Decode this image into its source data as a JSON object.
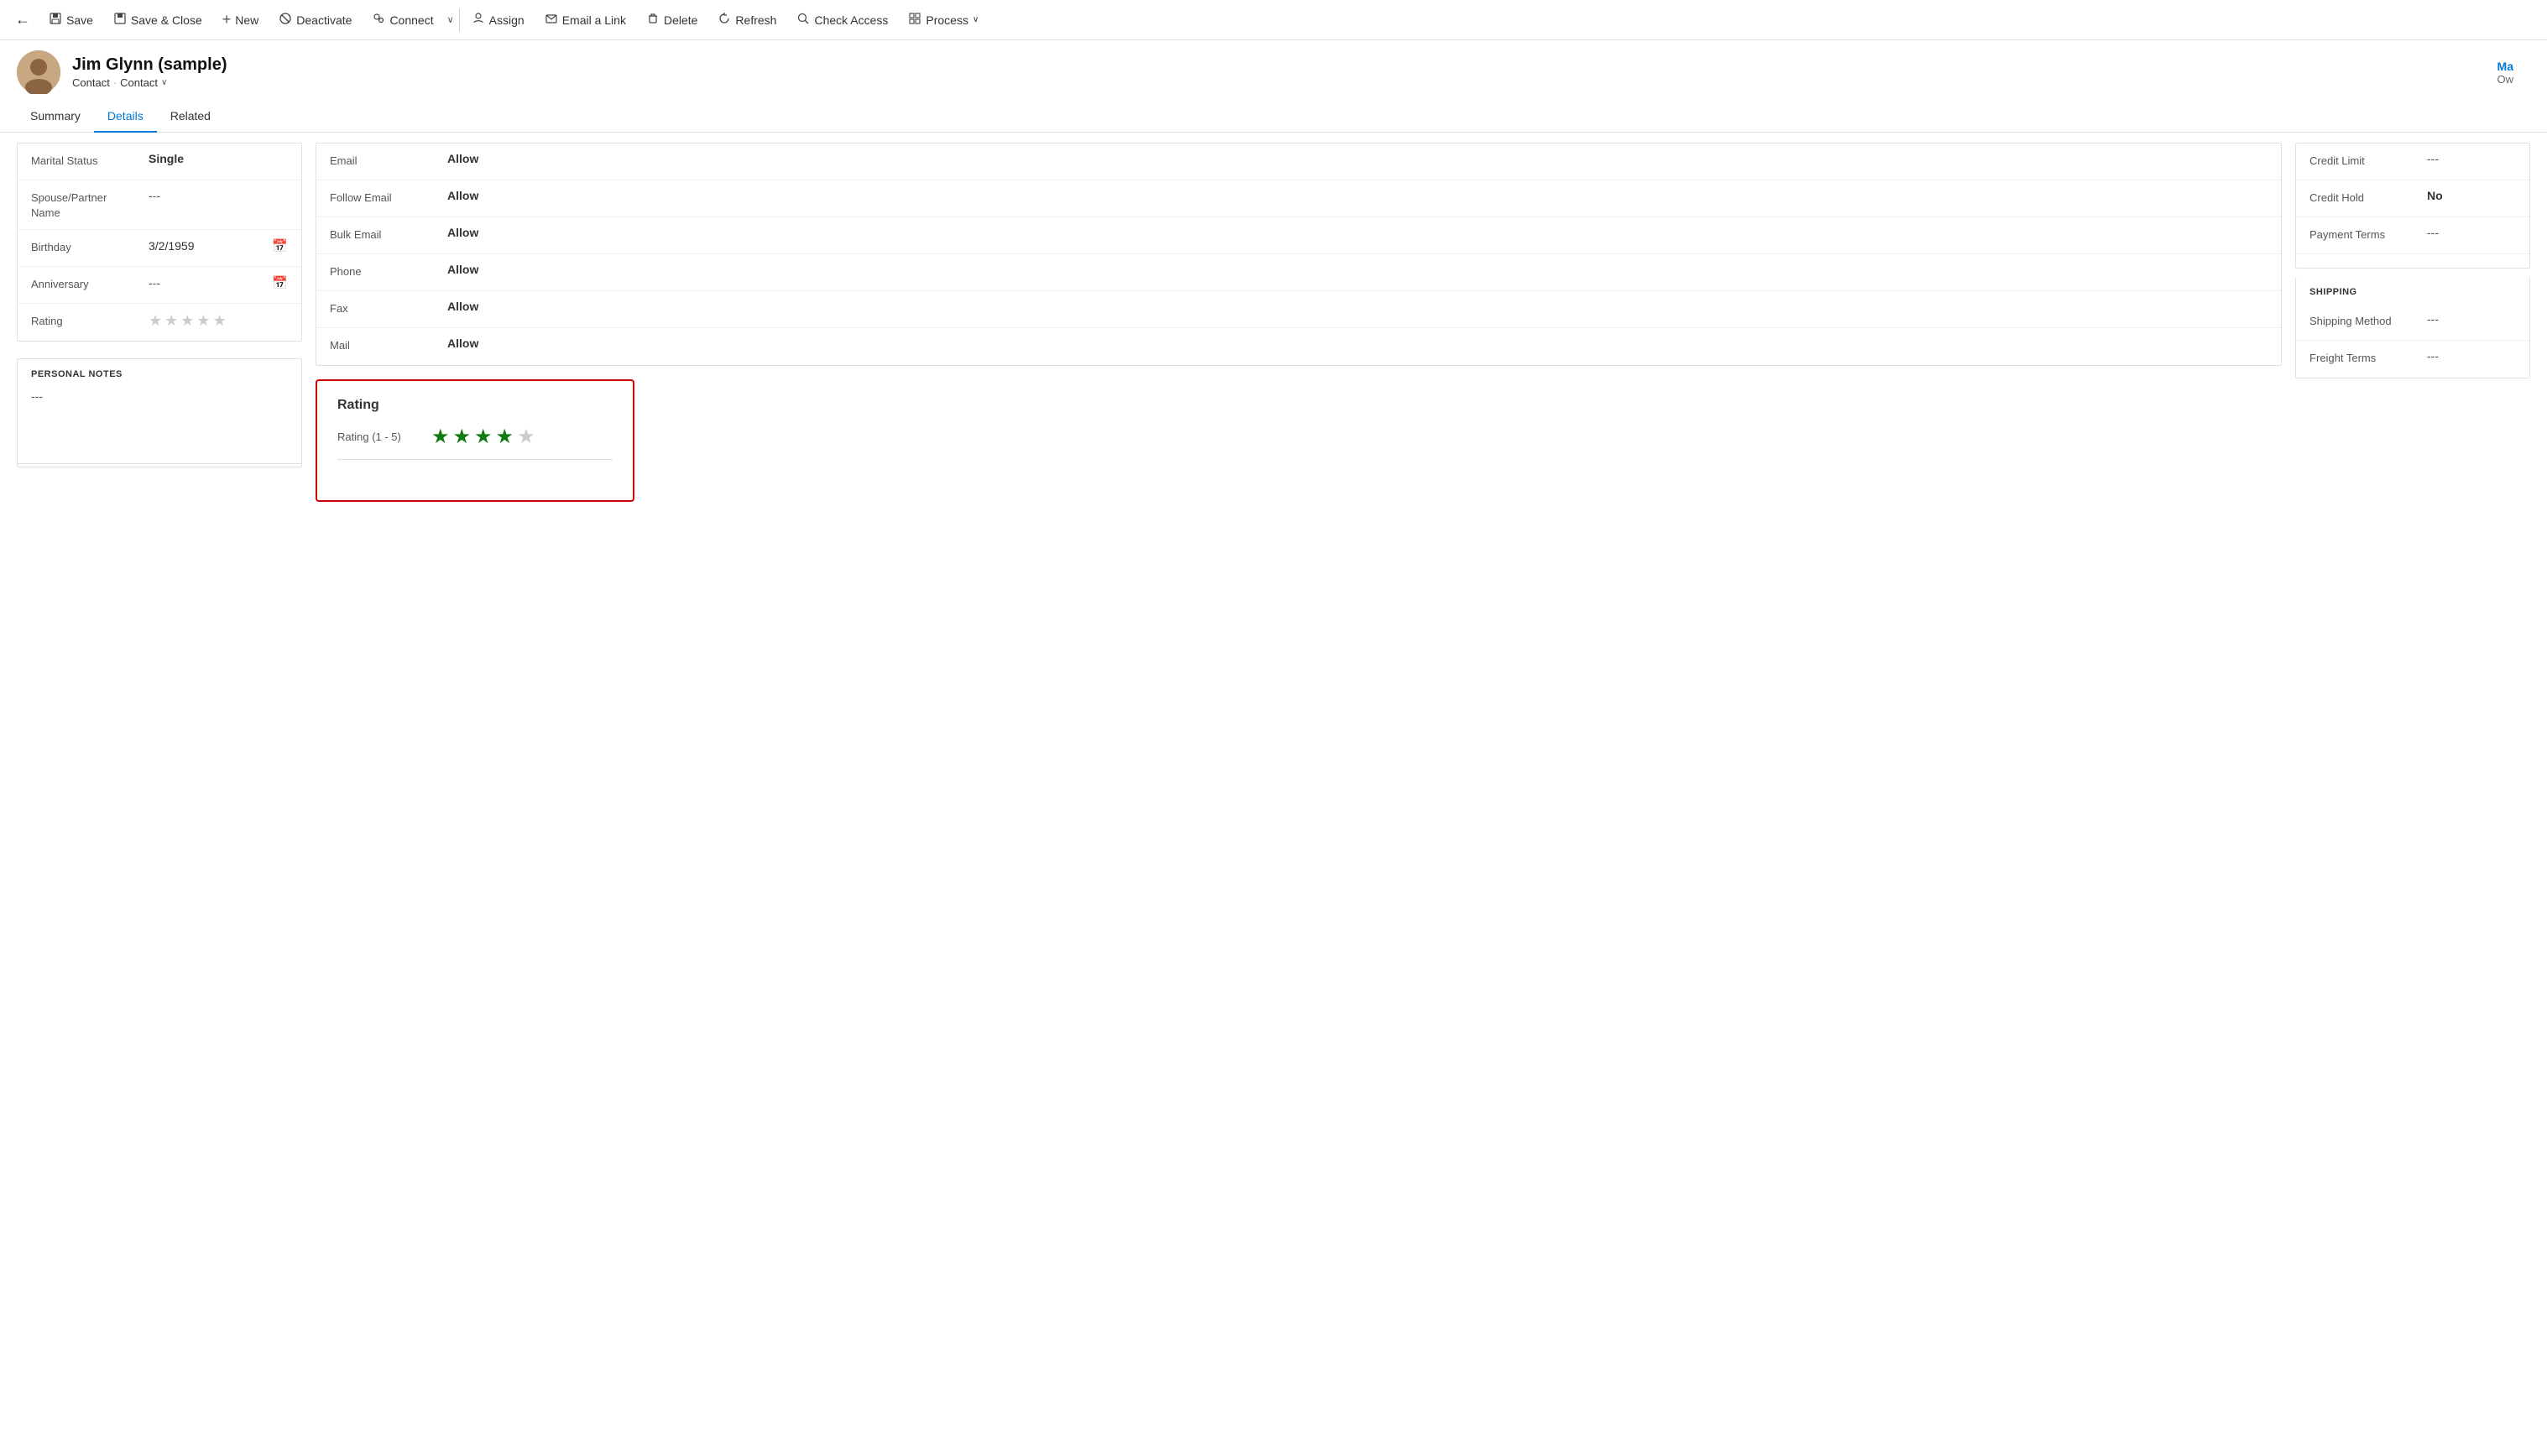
{
  "toolbar": {
    "back_icon": "←",
    "save_label": "Save",
    "save_icon": "💾",
    "save_close_label": "Save & Close",
    "save_close_icon": "💾",
    "new_label": "New",
    "new_icon": "+",
    "deactivate_label": "Deactivate",
    "deactivate_icon": "⊘",
    "connect_label": "Connect",
    "connect_icon": "👥",
    "assign_label": "Assign",
    "assign_icon": "👤",
    "email_link_label": "Email a Link",
    "email_link_icon": "✉",
    "delete_label": "Delete",
    "delete_icon": "🗑",
    "refresh_label": "Refresh",
    "refresh_icon": "↺",
    "check_access_label": "Check Access",
    "check_access_icon": "🔍",
    "process_label": "Process",
    "process_icon": "▦",
    "dropdown_arrow": "∨"
  },
  "contact": {
    "name": "Jim Glynn (sample)",
    "breadcrumb1": "Contact",
    "breadcrumb_sep": "·",
    "breadcrumb2": "Contact",
    "header_right_label": "Ma",
    "header_right_sub": "Ow"
  },
  "tabs": {
    "items": [
      {
        "label": "Summary",
        "active": false
      },
      {
        "label": "Details",
        "active": true
      },
      {
        "label": "Related",
        "active": false
      }
    ]
  },
  "personal_info": {
    "fields": [
      {
        "label": "Marital Status",
        "value": "Single",
        "empty": false,
        "type": "text"
      },
      {
        "label": "Spouse/Partner Name",
        "value": "---",
        "empty": true,
        "type": "text"
      },
      {
        "label": "Birthday",
        "value": "3/2/1959",
        "empty": false,
        "type": "date"
      },
      {
        "label": "Anniversary",
        "value": "---",
        "empty": true,
        "type": "date"
      },
      {
        "label": "Rating",
        "value": "",
        "empty": false,
        "type": "stars"
      }
    ]
  },
  "personal_notes": {
    "section_label": "PERSONAL NOTES",
    "value": "---"
  },
  "contact_preferences": {
    "fields": [
      {
        "label": "Email",
        "value": "Allow",
        "empty": false
      },
      {
        "label": "Follow Email",
        "value": "Allow",
        "empty": false
      },
      {
        "label": "Bulk Email",
        "value": "Allow",
        "empty": false
      },
      {
        "label": "Phone",
        "value": "Allow",
        "empty": false
      },
      {
        "label": "Fax",
        "value": "Allow",
        "empty": false
      },
      {
        "label": "Mail",
        "value": "Allow",
        "empty": false
      }
    ]
  },
  "billing": {
    "fields": [
      {
        "label": "Credit Limit",
        "value": "---",
        "empty": true
      },
      {
        "label": "Credit Hold",
        "value": "No",
        "empty": false
      },
      {
        "label": "Payment Terms",
        "value": "---",
        "empty": true
      }
    ]
  },
  "shipping": {
    "section_label": "SHIPPING",
    "fields": [
      {
        "label": "Shipping Method",
        "value": "---",
        "empty": true
      },
      {
        "label": "Freight Terms",
        "value": "---",
        "empty": true
      }
    ]
  },
  "rating_popup": {
    "title": "Rating",
    "label": "Rating (1 - 5)",
    "stars_filled": 4,
    "stars_total": 5
  }
}
